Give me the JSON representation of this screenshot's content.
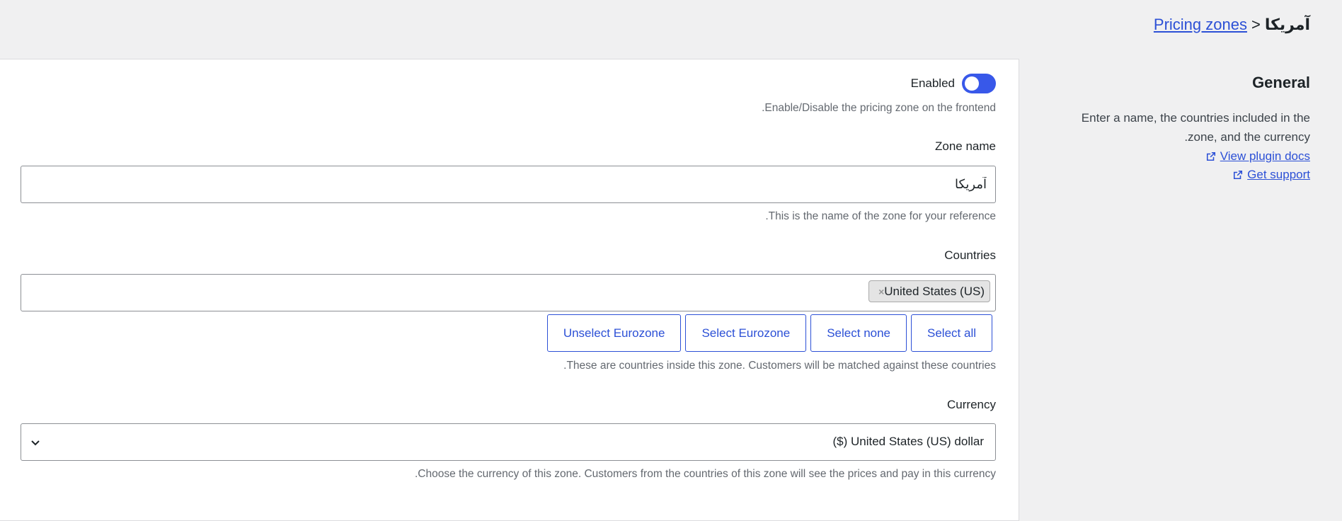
{
  "breadcrumb": {
    "parent": "Pricing zones",
    "separator": ">",
    "current": "آمریکا"
  },
  "sidebar": {
    "title": "General",
    "description_line1": "Enter a name, the countries included in the",
    "description_line2": ".zone, and the currency",
    "links": [
      {
        "label": "View plugin docs",
        "icon": "external-link-icon"
      },
      {
        "label": "Get support",
        "icon": "external-link-icon"
      }
    ]
  },
  "enabled": {
    "label": "Enabled",
    "state": "on",
    "help": ".Enable/Disable the pricing zone on the frontend"
  },
  "zone_name": {
    "label": "Zone name",
    "value": "آمریکا",
    "help": ".This is the name of the zone for your reference"
  },
  "countries": {
    "label": "Countries",
    "selected": [
      "United States (US)"
    ],
    "buttons": [
      "Select all",
      "Select none",
      "Select Eurozone",
      "Unselect Eurozone"
    ],
    "help": ".These are countries inside this zone. Customers will be matched against these countries"
  },
  "currency": {
    "label": "Currency",
    "value": "($) United States (US) dollar",
    "help": ".Choose the currency of this zone. Customers from the countries of this zone will see the prices and pay in this currency"
  },
  "colors": {
    "accent": "#2c50d6",
    "toggle": "#3858e9",
    "background": "#f0f0f1"
  }
}
